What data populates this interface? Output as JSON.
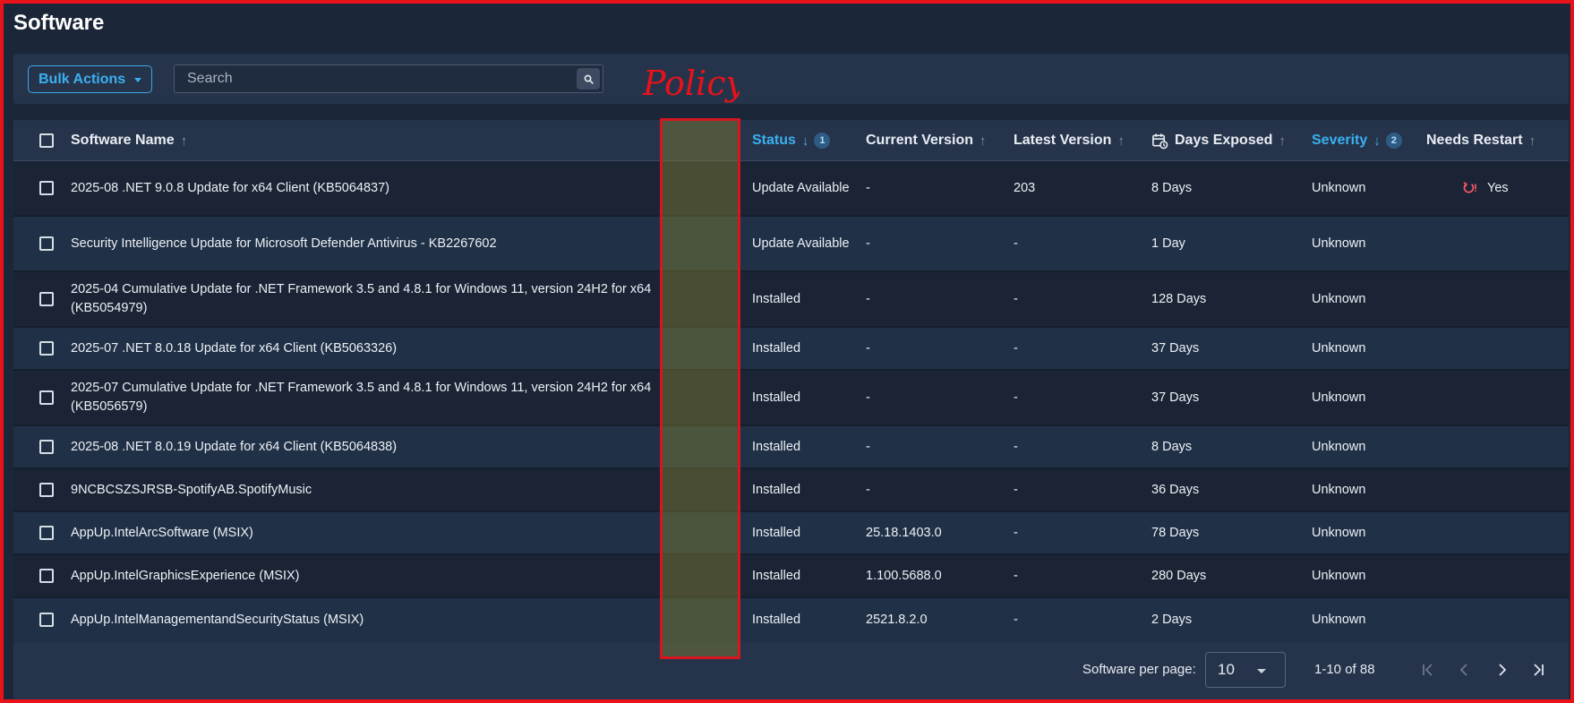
{
  "page": {
    "title": "Software"
  },
  "toolbar": {
    "bulk_actions_label": "Bulk Actions",
    "search_placeholder": "Search",
    "search_value": ""
  },
  "annotation": {
    "text": "Policy",
    "color": "#e8121b"
  },
  "table": {
    "columns": {
      "name": "Software Name",
      "status": "Status",
      "status_sort_order": "1",
      "current_version": "Current Version",
      "latest_version": "Latest Version",
      "days_exposed": "Days Exposed",
      "severity": "Severity",
      "severity_sort_order": "2",
      "needs_restart": "Needs Restart"
    },
    "rows": [
      {
        "name": "2025-08 .NET 9.0.8 Update for x64 Client (KB5064837)",
        "status": "Update Available",
        "current_version": "-",
        "latest_version": "203",
        "days_exposed": "8 Days",
        "severity": "Unknown",
        "needs_restart": "Yes"
      },
      {
        "name": "Security Intelligence Update for Microsoft Defender Antivirus - KB2267602",
        "status": "Update Available",
        "current_version": "-",
        "latest_version": "-",
        "days_exposed": "1 Day",
        "severity": "Unknown",
        "needs_restart": ""
      },
      {
        "name": "2025-04 Cumulative Update for .NET Framework 3.5 and 4.8.1 for Windows 11, version 24H2 for x64 (KB5054979)",
        "status": "Installed",
        "current_version": "-",
        "latest_version": "-",
        "days_exposed": "128 Days",
        "severity": "Unknown",
        "needs_restart": ""
      },
      {
        "name": "2025-07 .NET 8.0.18 Update for x64 Client (KB5063326)",
        "status": "Installed",
        "current_version": "-",
        "latest_version": "-",
        "days_exposed": "37 Days",
        "severity": "Unknown",
        "needs_restart": ""
      },
      {
        "name": "2025-07 Cumulative Update for .NET Framework 3.5 and 4.8.1 for Windows 11, version 24H2 for x64 (KB5056579)",
        "status": "Installed",
        "current_version": "-",
        "latest_version": "-",
        "days_exposed": "37 Days",
        "severity": "Unknown",
        "needs_restart": ""
      },
      {
        "name": "2025-08 .NET 8.0.19 Update for x64 Client (KB5064838)",
        "status": "Installed",
        "current_version": "-",
        "latest_version": "-",
        "days_exposed": "8 Days",
        "severity": "Unknown",
        "needs_restart": ""
      },
      {
        "name": "9NCBCSZSJRSB-SpotifyAB.SpotifyMusic",
        "status": "Installed",
        "current_version": "-",
        "latest_version": "-",
        "days_exposed": "36 Days",
        "severity": "Unknown",
        "needs_restart": ""
      },
      {
        "name": "AppUp.IntelArcSoftware (MSIX)",
        "status": "Installed",
        "current_version": "25.18.1403.0",
        "latest_version": "-",
        "days_exposed": "78 Days",
        "severity": "Unknown",
        "needs_restart": ""
      },
      {
        "name": "AppUp.IntelGraphicsExperience (MSIX)",
        "status": "Installed",
        "current_version": "1.100.5688.0",
        "latest_version": "-",
        "days_exposed": "280 Days",
        "severity": "Unknown",
        "needs_restart": ""
      },
      {
        "name": "AppUp.IntelManagementandSecurityStatus (MSIX)",
        "status": "Installed",
        "current_version": "2521.8.2.0",
        "latest_version": "-",
        "days_exposed": "2 Days",
        "severity": "Unknown",
        "needs_restart": ""
      }
    ]
  },
  "pagination": {
    "per_page_label": "Software per page:",
    "per_page_value": "10",
    "range_text": "1-10 of 88"
  },
  "colors": {
    "accent": "#3ab0f0",
    "background": "#1b2638",
    "annotation_border": "#e8121b",
    "restart_icon": "#ff5a6a"
  }
}
